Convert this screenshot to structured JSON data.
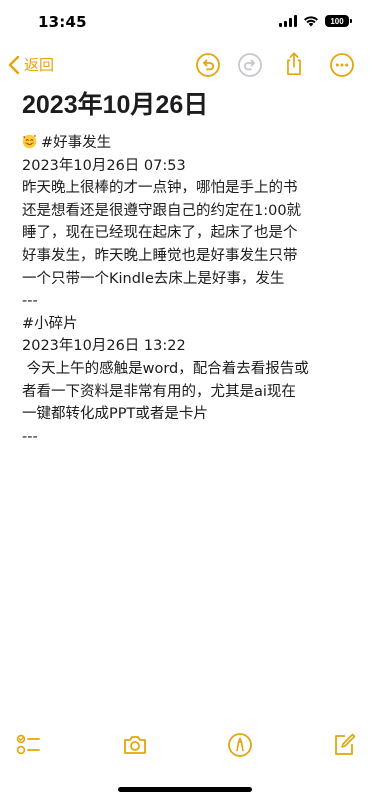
{
  "status_bar": {
    "time": "13:45",
    "battery": "100"
  },
  "nav": {
    "back_label": "返回",
    "accent_color": "#e5a50a"
  },
  "note": {
    "title": "2023年10月26日",
    "lines": [
      "#好事发生",
      "2023年10月26日 07:53",
      "昨天晚上很棒的才一点钟，哪怕是手上的书",
      "还是想看还是很遵守跟自己的约定在1:00就",
      "睡了，现在已经现在起床了，起床了也是个",
      "好事发生，昨天晚上睡觉也是好事发生只带",
      "一个只带一个Kindle去床上是好事，发生",
      "---",
      "#小碎片",
      "2023年10月26日 13:22",
      " 今天上午的感触是word，配合着去看报告或",
      "者看一下资料是非常有用的，尤其是ai现在",
      "一键都转化成PPT或者是卡片",
      "---"
    ]
  },
  "icons": {
    "back": "chevron-left-icon",
    "undo": "undo-icon",
    "redo": "redo-icon",
    "share": "share-icon",
    "more": "more-icon",
    "checklist": "checklist-icon",
    "camera": "camera-icon",
    "markup": "markup-pen-icon",
    "compose": "compose-icon",
    "emoji": "smiling-face-with-hearts-emoji"
  }
}
